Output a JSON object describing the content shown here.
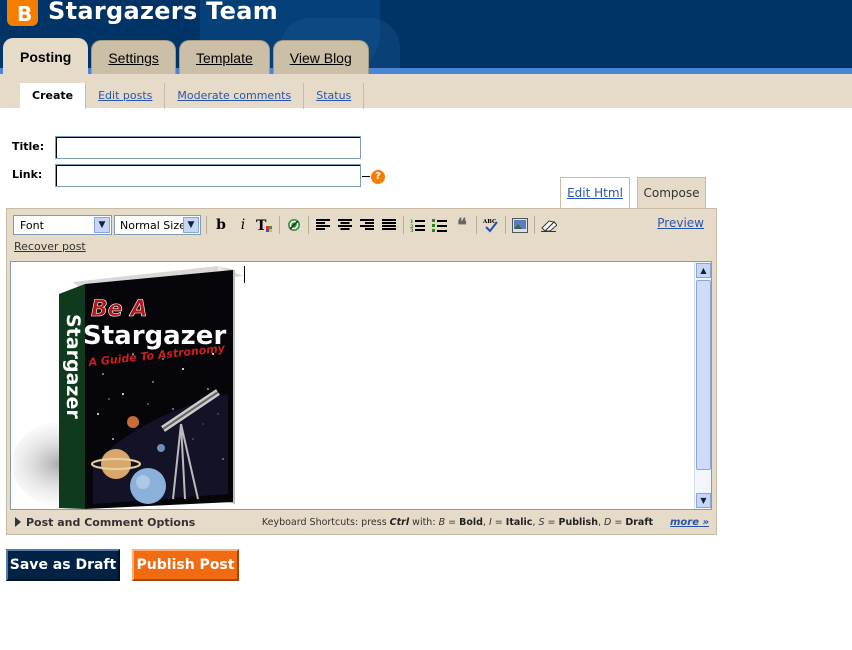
{
  "header": {
    "logo_letter": "B",
    "site_title": "Stargazers Team"
  },
  "tabs": [
    {
      "label": "Posting",
      "active": true
    },
    {
      "label": "Settings",
      "active": false
    },
    {
      "label": "Template",
      "active": false
    },
    {
      "label": "View Blog",
      "active": false
    }
  ],
  "subnav": [
    {
      "label": "Create",
      "active": true
    },
    {
      "label": "Edit posts",
      "active": false
    },
    {
      "label": "Moderate comments",
      "active": false
    },
    {
      "label": "Status",
      "active": false
    }
  ],
  "form": {
    "title_label": "Title:",
    "title_value": "",
    "link_label": "Link:",
    "link_value": "",
    "help_glyph": "?"
  },
  "mode_tabs": {
    "edit_html": "Edit Html",
    "compose": "Compose"
  },
  "toolbar": {
    "font_select": "Font",
    "size_select": "Normal Size",
    "preview_label": "Preview",
    "recover_label": "Recover post"
  },
  "book": {
    "line1": "Be A",
    "line2": "Stargazer",
    "line3": "A Guide To Astronomy",
    "spine": "Stargazer"
  },
  "footer": {
    "post_options": "Post and Comment Options",
    "shortcuts_prefix": "Keyboard Shortcuts: press",
    "ctrl": "Ctrl",
    "with": "with:",
    "b": "B",
    "bold": "Bold",
    "i": "I",
    "italic": "Italic",
    "s": "S",
    "publish": "Publish",
    "d": "D",
    "draft": "Draft",
    "more": "more »"
  },
  "buttons": {
    "save_draft": "Save as Draft",
    "publish": "Publish Post"
  },
  "colors": {
    "header_bg": "#003366",
    "accent_orange": "#f57d00",
    "panel_beige": "#e5dbc8",
    "link_blue": "#2b56a8"
  }
}
